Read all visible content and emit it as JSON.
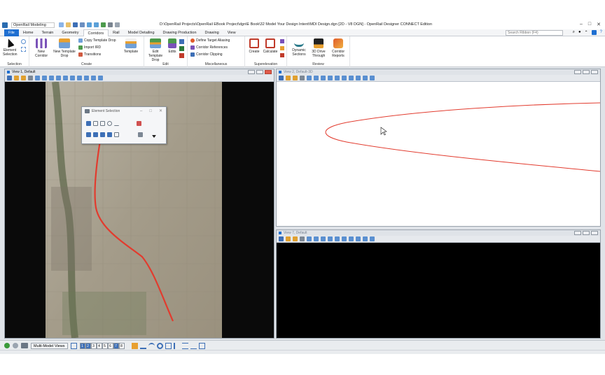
{
  "titlebar": {
    "workspace": "OpenRail Modeling",
    "title": "D:\\OpenRail Projects\\OpenRail EBook Project\\dgn\\E Book\\32 Model Your Design Intent\\MDI Design.dgn [2D - V8 DGN] - OpenRail Designer CONNECT Edition",
    "controls": [
      "–",
      "□",
      "✕"
    ]
  },
  "tabs": [
    "File",
    "Home",
    "Terrain",
    "Geometry",
    "Corridors",
    "Rail",
    "Model Detailing",
    "Drawing Production",
    "Drawing",
    "View"
  ],
  "active_tab": "Corridors",
  "search": {
    "placeholder": "Search Ribbon (F4)"
  },
  "ribbon": {
    "selection": {
      "label": "Selection",
      "element_selection": "Element Selection"
    },
    "create": {
      "label": "Create",
      "new_corridor": "New Corridor",
      "new_template_drop": "New Template Drop",
      "copy_template_drop": "Copy Template Drop",
      "import_ird": "Import IRD",
      "transitions": "Transitions",
      "template": "Template"
    },
    "edit": {
      "label": "Edit",
      "edit_template_drop": "Edit Template Drop",
      "edits": "Edits"
    },
    "misc": {
      "label": "Miscellaneous",
      "define_target_aliasing": "Define Target Aliasing",
      "corridor_references": "Corridor References",
      "corridor_clipping": "Corridor Clipping"
    },
    "superelevation": {
      "label": "Superelevation",
      "create": "Create",
      "calculate": "Calculate"
    },
    "review": {
      "label": "Review",
      "dynamic_sections": "Dynamic Sections",
      "drive_through": "3D Drive Through",
      "corridor_reports": "Corridor Reports"
    }
  },
  "views": {
    "v1": {
      "title": "View 1, Default"
    },
    "v2": {
      "title": "View 2, Default-3D"
    },
    "v7": {
      "title": "View 7, Default"
    }
  },
  "element_selection": {
    "title": "Element Selection",
    "controls": [
      "–",
      "□",
      "✕"
    ]
  },
  "statusbar": {
    "multi_model_views": "Multi-Model Views",
    "view_numbers": [
      "1",
      "2",
      "3",
      "4",
      "5",
      "6",
      "7",
      "8"
    ],
    "active_views": [
      "1",
      "2",
      "7"
    ]
  },
  "colors": {
    "accent": "#1f6fd1",
    "alignment": "#e23b2e",
    "view_bg_3d": "#ffffff",
    "view_bg_7": "#000000"
  }
}
